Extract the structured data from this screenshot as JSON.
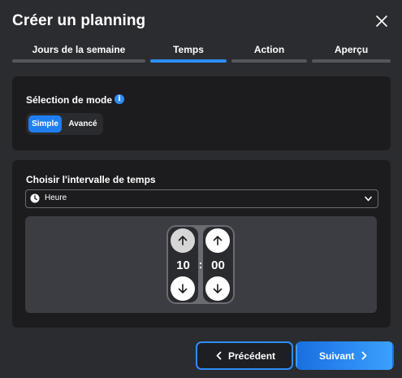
{
  "dialog": {
    "title": "Créer un planning",
    "close_icon": "close-icon"
  },
  "steps": [
    {
      "label": "Jours de la semaine",
      "active": false
    },
    {
      "label": "Temps",
      "active": true
    },
    {
      "label": "Action",
      "active": false
    },
    {
      "label": "Aperçu",
      "active": false
    }
  ],
  "mode_panel": {
    "title": "Sélection de mode",
    "info_icon": "info-icon",
    "options": [
      "Simple",
      "Avancé"
    ],
    "selected": "Simple"
  },
  "interval_panel": {
    "title": "Choisir l'intervalle de temps",
    "select_value": "Heure",
    "select_icon": "clock-icon",
    "hours": "10",
    "separator": ":",
    "minutes": "00"
  },
  "footer": {
    "prev_label": "Précédent",
    "next_label": "Suivant"
  },
  "colors": {
    "accent": "#2f8df5",
    "background": "#2b2c30",
    "panel": "#1c1c1f"
  }
}
